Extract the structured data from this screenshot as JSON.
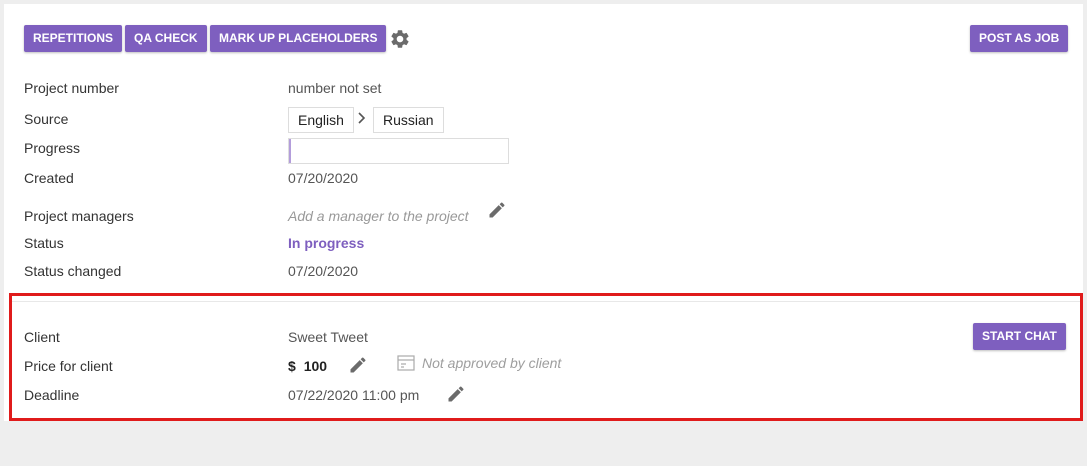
{
  "toolbar": {
    "repetitions_label": "REPETITIONS",
    "qa_check_label": "QA CHECK",
    "mark_up_label": "MARK UP PLACEHOLDERS",
    "settings_icon": "gear-icon",
    "post_as_job_label": "POST AS JOB"
  },
  "project": {
    "number_label": "Project number",
    "number_value": "number not set",
    "source_label": "Source",
    "source_lang": "English",
    "target_lang": "Russian",
    "progress_label": "Progress",
    "progress_value": 0.01,
    "created_label": "Created",
    "created_value": "07/20/2020",
    "managers_label": "Project managers",
    "managers_placeholder": "Add a manager to the project",
    "status_label": "Status",
    "status_value": "In progress",
    "status_changed_label": "Status changed",
    "status_changed_value": "07/20/2020"
  },
  "client": {
    "client_label": "Client",
    "client_value": "Sweet Tweet",
    "start_chat_label": "START CHAT",
    "price_label": "Price for client",
    "currency": "$",
    "price_value": "100",
    "approval_text": "Not approved by client",
    "deadline_label": "Deadline",
    "deadline_value": "07/22/2020 11:00 pm"
  },
  "colors": {
    "accent": "#7e5fbf",
    "highlight": "#e01b1b",
    "progress_fill": "#b39ddb"
  }
}
